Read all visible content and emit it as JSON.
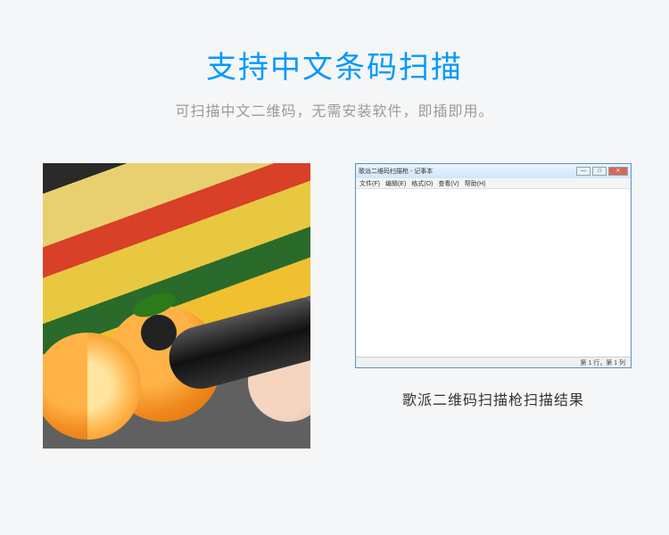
{
  "header": {
    "title": "支持中文条码扫描",
    "subtitle": "可扫描中文二维码，无需安装软件，即插即用。"
  },
  "notepad": {
    "title": "歌派二维码扫描枪 - 记事本",
    "menu": [
      "文件(F)",
      "编辑(E)",
      "格式(O)",
      "查看(V)",
      "帮助(H)"
    ],
    "status": "第 1 行，第 1 列",
    "buttons": {
      "min": "—",
      "max": "□",
      "close": "✕"
    }
  },
  "caption": "歌派二维码扫描枪扫描结果"
}
